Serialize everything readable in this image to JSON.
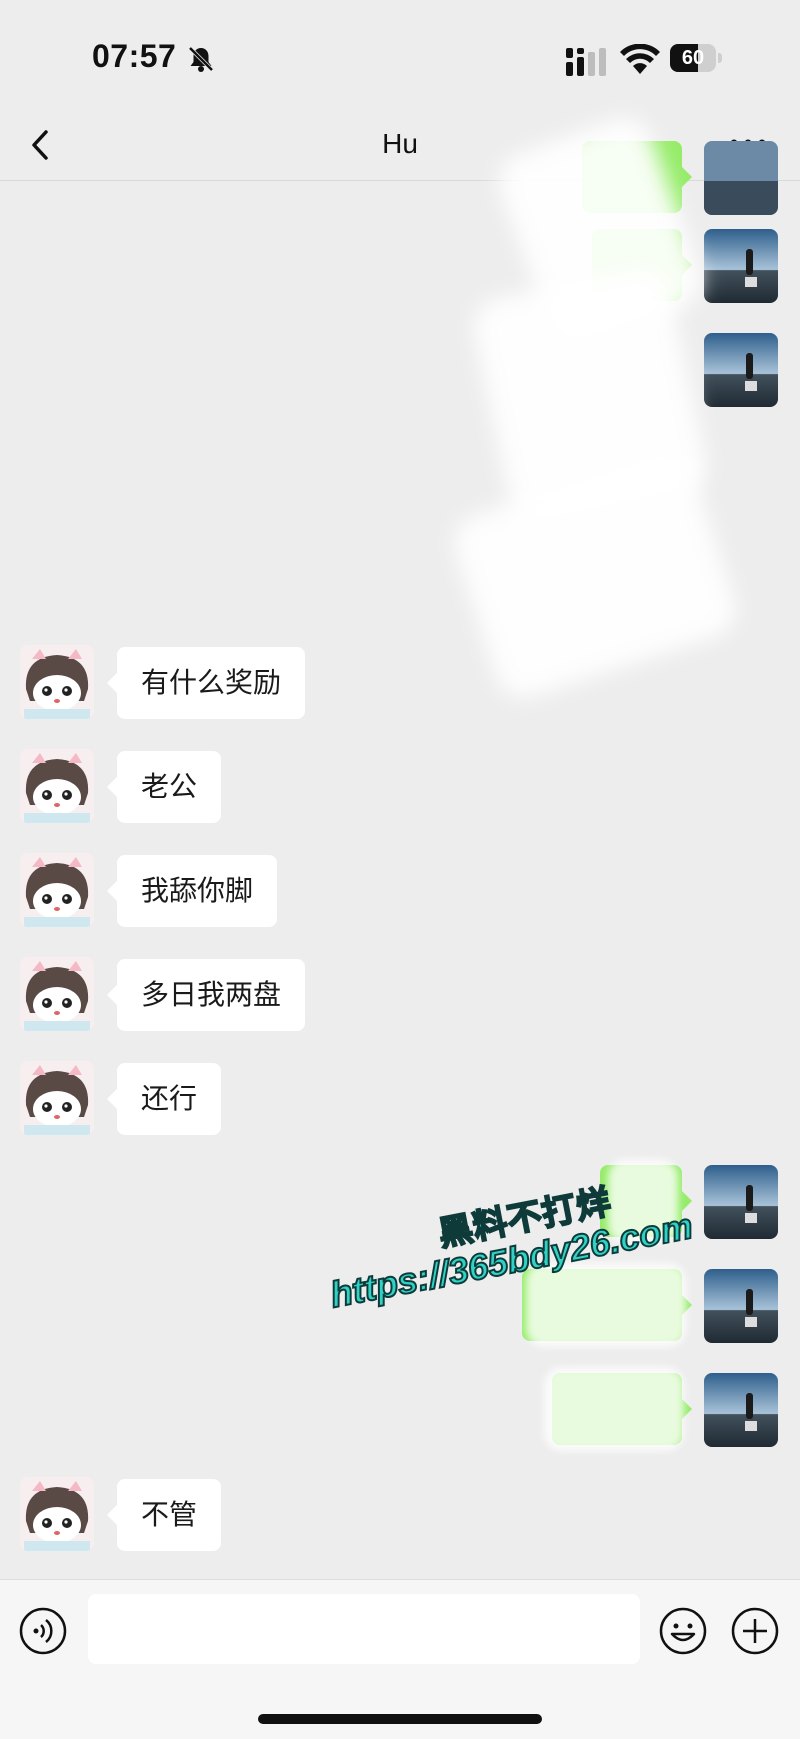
{
  "status_bar": {
    "time": "07:57",
    "battery": "60",
    "battery_level": 0.6,
    "icons": [
      "bell-muted-icon",
      "cellular-signal-icon",
      "wifi-icon",
      "battery-icon"
    ]
  },
  "nav": {
    "title": "Hu",
    "back_icon": "chevron-left-icon",
    "more_icon": "ellipsis-icon"
  },
  "messages_incoming": [
    {
      "text": "有什么奖励"
    },
    {
      "text": "老公"
    },
    {
      "text": "我舔你脚"
    },
    {
      "text": "多日我两盘"
    },
    {
      "text": "还行"
    },
    {
      "text": "不管"
    }
  ],
  "watermark": {
    "line1": "黑料不打烊",
    "line2": "https://365bdy26.com"
  },
  "input_bar": {
    "placeholder": "",
    "icons": [
      "voice-icon",
      "emoji-icon",
      "plus-icon"
    ]
  },
  "colors": {
    "background": "#ededed",
    "bubble_in": "#ffffff",
    "bubble_out": "#95ec69",
    "watermark": "#2fd3c6"
  }
}
